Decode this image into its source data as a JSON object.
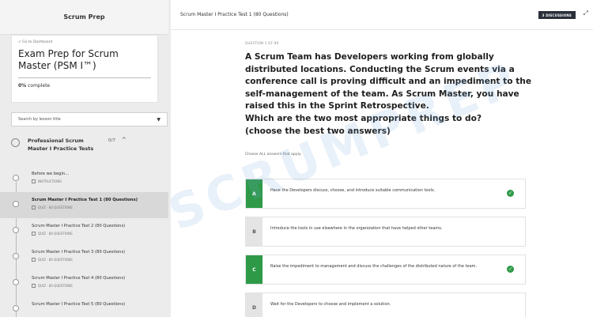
{
  "sidebar": {
    "header": "Scrum Prep",
    "back_link": "< Go to Dashboard",
    "course_title": "Exam Prep for Scrum Master (PSM I™)",
    "progress_percent": "0%",
    "progress_suffix": " complete",
    "search_placeholder": "Search by lesson title",
    "section": {
      "title": "Professional Scrum Master I Practice Tests",
      "count": "0/7"
    },
    "lessons": [
      {
        "title": "Before we begin...",
        "meta": "INSTRUCTIONS"
      },
      {
        "title": "Scrum Master I Practice Test 1 (80 Questions)",
        "meta": "QUIZ · 80 QUESTIONS"
      },
      {
        "title": "Scrum Master I Practice Test 2 (80 Questions)",
        "meta": "QUIZ · 80 QUESTIONS"
      },
      {
        "title": "Scrum Master I Practice Test 3 (80 Questions)",
        "meta": "QUIZ · 80 QUESTIONS"
      },
      {
        "title": "Scrum Master I Practice Test 4 (80 Questions)",
        "meta": "QUIZ · 80 QUESTIONS"
      },
      {
        "title": "Scrum Master I Practice Test 5 (80 Questions)",
        "meta": ""
      }
    ]
  },
  "main": {
    "topbar_title": "Scrum Master I Practice Test 1 (80 Questions)",
    "discussion_label": "3 DISCUSSIONS",
    "question_counter": "QUESTION 1 OF 80",
    "question_text": "A Scrum Team has Developers working from globally distributed locations. Conducting the Scrum events via a conference call is proving difficult and an impediment to the self-management of the team. As Scrum Master, you have raised this in the Sprint Retrospective.\nWhich are the two most appropriate things to do?\n(choose the best two answers)",
    "instruction": "Choose ALL answers that apply.",
    "answers": [
      {
        "letter": "A",
        "text": "Have the Developers discuss, choose, and introduce suitable communication tools."
      },
      {
        "letter": "B",
        "text": "Introduce the tools in use elsewhere in the organization that have helped other teams."
      },
      {
        "letter": "C",
        "text": "Raise the impediment to management and discuss the challenges of the distributed nature of the team."
      },
      {
        "letter": "D",
        "text": "Wait for the Developers to choose and implement a solution."
      }
    ]
  },
  "watermark": "SCRUMPREP",
  "colors": {
    "correct": "#2e9a48",
    "discussion_button": "#2a2f3a"
  }
}
